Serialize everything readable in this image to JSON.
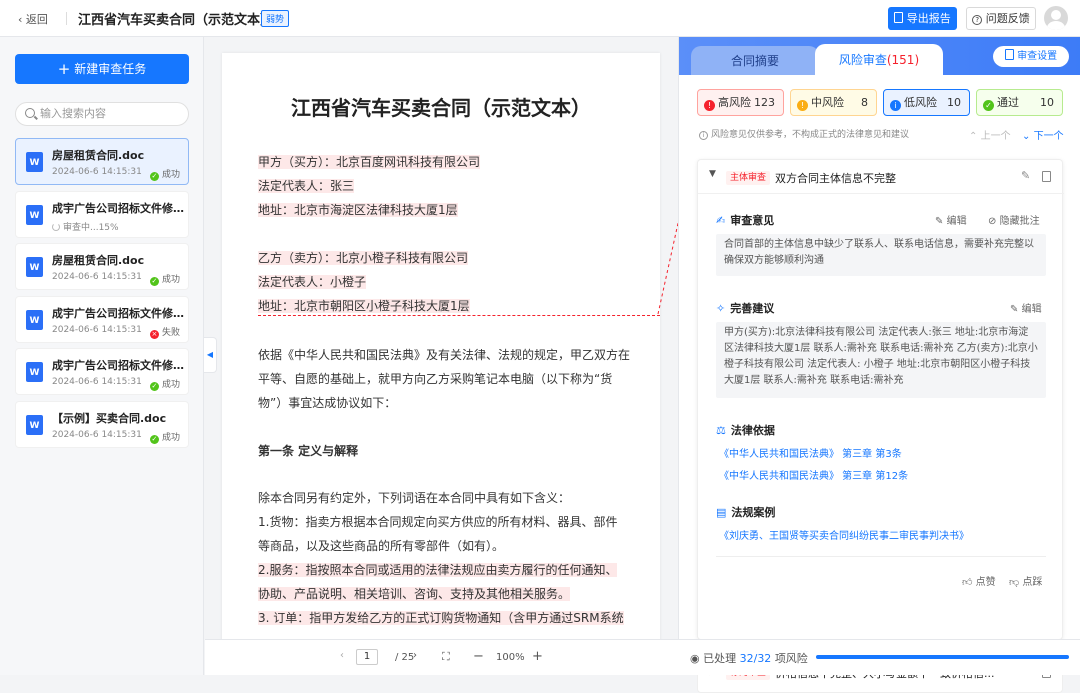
{
  "header": {
    "back_label": "返回",
    "title": "江西省汽车买卖合同（示范文本）",
    "tag": "弱势",
    "export_label": "导出报告",
    "feedback_label": "问题反馈"
  },
  "sidebar": {
    "new_task_label": "新建审查任务",
    "search_placeholder": "输入搜索内容",
    "files": [
      {
        "name": "房屋租赁合同.doc",
        "date": "2024-06-6 14:15:31",
        "status": "成功"
      },
      {
        "name": "成宇广告公司招标文件修...",
        "date": "",
        "status": "审查中...15%"
      },
      {
        "name": "房屋租赁合同.doc",
        "date": "2024-06-6 14:15:31",
        "status": "成功"
      },
      {
        "name": "成宇广告公司招标文件修...",
        "date": "2024-06-6 14:15:31",
        "status": "失败"
      },
      {
        "name": "成宇广告公司招标文件修...",
        "date": "2024-06-6 14:15:31",
        "status": "成功"
      },
      {
        "name": "【示例】买卖合同.doc",
        "date": "2024-06-6 14:15:31",
        "status": "成功"
      }
    ]
  },
  "document": {
    "title": "江西省汽车买卖合同（示范文本）",
    "buyer": "甲方（买方）：北京百度网讯科技有限公司",
    "buyer_rep": "法定代表人：张三",
    "buyer_addr": "地址：北京市海淀区法律科技大厦1层",
    "seller": "乙方（卖方）：北京小橙子科技有限公司",
    "seller_rep": "法定代表人：小橙子",
    "seller_addr": "地址：北京市朝阳区小橙子科技大厦1层",
    "intro": "依据《中华人民共和国民法典》及有关法律、法规的规定，甲乙双方在平等、自愿的基础上，就甲方向乙方采购笔记本电脑（以下称为“货物”）事宜达成协议如下：",
    "article1": "第一条 定义与解释",
    "def_intro": "除本合同另有约定外，下列词语在本合同中具有如下含义：",
    "def1a": "1.货物：指卖方根据本合同规定向买方供应的所有材料、器具、部件",
    "def1b": "等商品，以及这些商品的所有零部件（如有）。",
    "def2a": "2.服务：指按照本合同或适用的法律法规应由卖方履行的任何通知、",
    "def2b": "协助、产品说明、相关培训、咨询、支持及其他相关服务。",
    "def3a": "3. 订单：指甲方发给乙方的正式订购货物通知（含甲方通过SRM系统",
    "footer": {
      "page": "1",
      "total": "/ 25",
      "zoom": "100%",
      "minus": "−",
      "plus": "+"
    }
  },
  "review": {
    "tab_summary": "合同摘要",
    "tab_risk": "风险审查",
    "tab_risk_count": "(151)",
    "settings_label": "审查设置",
    "chips": [
      {
        "label": "高风险",
        "count": "123",
        "color": "#f5222d"
      },
      {
        "label": "中风险",
        "count": "8",
        "color": "#faad14"
      },
      {
        "label": "低风险",
        "count": "10",
        "color": "#1677ff"
      },
      {
        "label": "通过",
        "count": "10",
        "color": "#52c41a"
      }
    ],
    "note": "风险意见仅供参考，不构成正式的法律意见和建议",
    "prev_label": "上一个",
    "next_label": "下一个",
    "card1": {
      "tag": "主体审查",
      "title": "双方合同主体信息不完整",
      "opinion_label": "审查意见",
      "edit_label": "编辑",
      "hide_label": "隐藏批注",
      "opinion_text": "合同首部的主体信息中缺少了联系人、联系电话信息，需要补充完整以确保双方能够顺利沟通",
      "suggest_label": "完善建议",
      "suggest_text": "甲方(买方):北京法律科技有限公司 法定代表人:张三 地址:北京市海淀区法律科技大厦1层 联系人:需补充 联系电话:需补充 乙方(卖方):北京小橙子科技有限公司 法定代表人: 小橙子 地址:北京市朝阳区小橙子科技大厦1层 联系人:需补充 联系电话:需补充",
      "law_label": "法律依据",
      "law1": "《中华人民共和国民法典》 第三章 第3条",
      "law2": "《中华人民共和国民法典》 第三章 第12条",
      "case_label": "法规案例",
      "case1": "《刘庆勇、王国贤等买卖合同纠纷民事二审民事判决书》",
      "like_label": "点赞",
      "dislike_label": "点踩"
    },
    "card2": {
      "tag": "标的审查",
      "title": "价格信息不完整、大小写金额不一致价格信..."
    },
    "footer": {
      "processed_label": "已处理",
      "processed_count": "32/32",
      "risk_suffix": "项风险",
      "progress": 1.0
    }
  }
}
